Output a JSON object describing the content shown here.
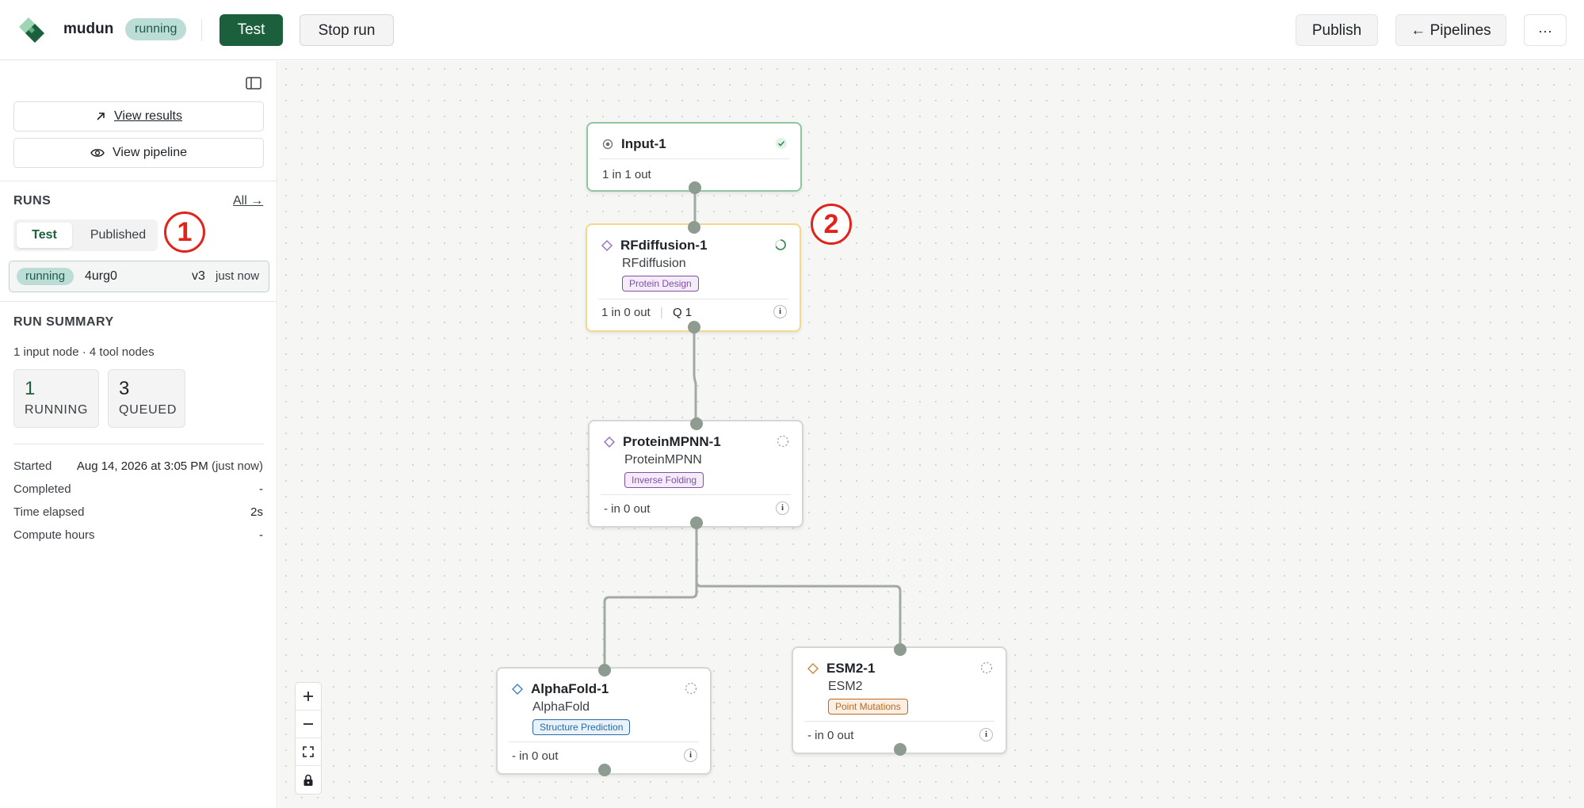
{
  "header": {
    "app_name": "mudun",
    "status_badge": "running",
    "test_label": "Test",
    "stop_run_label": "Stop run",
    "publish_label": "Publish",
    "pipelines_label": "← Pipelines",
    "more_label": "···"
  },
  "sidebar": {
    "view_results_label": "View results",
    "view_pipeline_label": "View pipeline",
    "runs_title": "RUNS",
    "all_link": "All →",
    "tabs": {
      "test": "Test",
      "published": "Published"
    },
    "run": {
      "status": "running",
      "id": "4urg0",
      "version": "v3",
      "time": "just now"
    },
    "summary_title": "RUN SUMMARY",
    "summary_subtitle": "1 input node · 4 tool nodes",
    "stats": [
      {
        "value": "1",
        "label": "RUNNING"
      },
      {
        "value": "3",
        "label": "QUEUED"
      }
    ],
    "meta": [
      {
        "label": "Started",
        "value": "Aug 14, 2026 at 3:05 PM",
        "value_note": "(just now)"
      },
      {
        "label": "Completed",
        "value": "-"
      },
      {
        "label": "Time elapsed",
        "value": "2s"
      },
      {
        "label": "Compute hours",
        "value": "-"
      }
    ]
  },
  "annotations": [
    "1",
    "2"
  ],
  "nodes": [
    {
      "title": "Input-1",
      "io": "1 in 1 out",
      "status": "done"
    },
    {
      "title": "RFdiffusion-1",
      "tool": "RFdiffusion",
      "tag": "Protein Design",
      "io": "1 in 0 out",
      "queue": "Q 1",
      "status": "running"
    },
    {
      "title": "ProteinMPNN-1",
      "tool": "ProteinMPNN",
      "tag": "Inverse Folding",
      "io": "- in 0 out",
      "status": "queued"
    },
    {
      "title": "AlphaFold-1",
      "tool": "AlphaFold",
      "tag": "Structure Prediction",
      "io": "- in 0 out",
      "status": "queued"
    },
    {
      "title": "ESM2-1",
      "tool": "ESM2",
      "tag": "Point Mutations",
      "io": "- in 0 out",
      "status": "queued"
    }
  ],
  "info_glyph": "i",
  "colors": {
    "brand_green": "#1c5f3d",
    "running_badge_bg": "#bcdcd6",
    "input_border": "#8fc5a0",
    "running_border": "#f2d98c",
    "annotation_red": "#e2231a"
  }
}
